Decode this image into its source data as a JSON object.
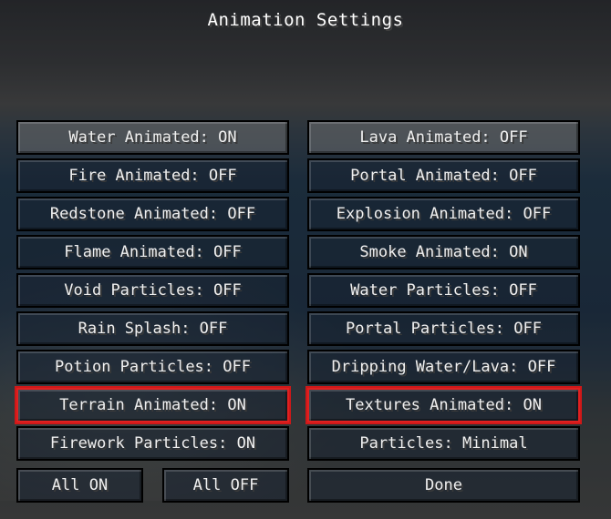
{
  "screen": {
    "title": "Animation Settings"
  },
  "left_column": [
    {
      "label": "Water Animated: ON"
    },
    {
      "label": "Fire Animated: OFF"
    },
    {
      "label": "Redstone Animated: OFF"
    },
    {
      "label": "Flame Animated: OFF"
    },
    {
      "label": "Void Particles: OFF"
    },
    {
      "label": "Rain Splash: OFF"
    },
    {
      "label": "Potion Particles: OFF"
    },
    {
      "label": "Terrain Animated: ON",
      "highlighted": true
    },
    {
      "label": "Firework Particles: ON"
    }
  ],
  "right_column": [
    {
      "label": "Lava Animated: OFF"
    },
    {
      "label": "Portal Animated: OFF"
    },
    {
      "label": "Explosion Animated: OFF"
    },
    {
      "label": "Smoke Animated: ON"
    },
    {
      "label": "Water Particles: OFF"
    },
    {
      "label": "Portal Particles: OFF"
    },
    {
      "label": "Dripping Water/Lava: OFF"
    },
    {
      "label": "Textures Animated: ON",
      "highlighted": true
    },
    {
      "label": "Particles: Minimal"
    }
  ],
  "bottom": {
    "all_on": "All ON",
    "all_off": "All OFF",
    "done": "Done"
  },
  "colors": {
    "highlight": "#e02020",
    "text": "#f0f0f0"
  }
}
